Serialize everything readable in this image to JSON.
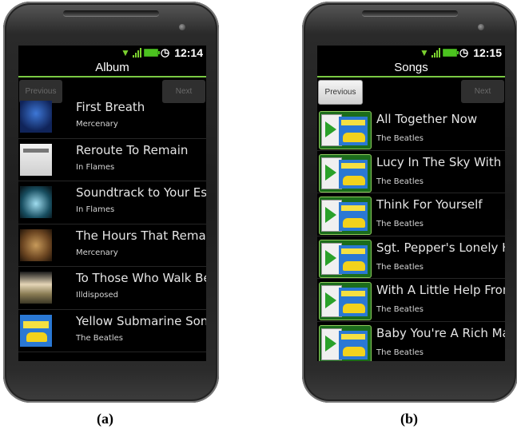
{
  "captions": [
    "(a)",
    "(b)"
  ],
  "phone_a": {
    "status": {
      "time": "12:14"
    },
    "title": "Album",
    "nav": {
      "previous": "Previous",
      "next": "Next"
    },
    "items": [
      {
        "title": "First Breath",
        "subtitle": "Mercenary",
        "art": "blue"
      },
      {
        "title": "Reroute To Remain",
        "subtitle": "In Flames",
        "art": "white"
      },
      {
        "title": "Soundtrack to Your Esca",
        "subtitle": "In Flames",
        "art": "cyan"
      },
      {
        "title": "The Hours That Remain",
        "subtitle": "Mercenary",
        "art": "gold"
      },
      {
        "title": "To Those Who Walk Beh",
        "subtitle": "Illdisposed",
        "art": "warm"
      },
      {
        "title": "Yellow Submarine Songt",
        "subtitle": "The Beatles",
        "art": "sub"
      }
    ]
  },
  "phone_b": {
    "status": {
      "time": "12:15"
    },
    "title": "Songs",
    "nav": {
      "previous": "Previous",
      "next": "Next"
    },
    "items": [
      {
        "title": "All Together Now",
        "subtitle": "The Beatles"
      },
      {
        "title": "Lucy In The Sky With Dia",
        "subtitle": "The Beatles"
      },
      {
        "title": "Think For Yourself",
        "subtitle": "The Beatles"
      },
      {
        "title": "Sgt. Pepper's Lonely Hea",
        "subtitle": "The Beatles"
      },
      {
        "title": "With A Little Help From M",
        "subtitle": "The Beatles"
      },
      {
        "title": "Baby You're A Rich Man",
        "subtitle": "The Beatles"
      }
    ]
  },
  "colors": {
    "accent_green": "#7ac943",
    "screen_bg": "#000000"
  }
}
